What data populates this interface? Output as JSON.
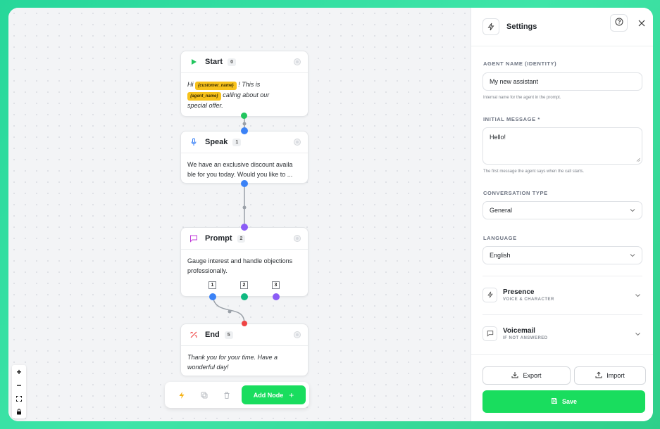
{
  "nodes": {
    "start": {
      "title": "Start",
      "badge": "0",
      "text_hi": "Hi",
      "var1": "{customer_name}",
      "text_mid": "! This is",
      "var2": "{agent_name}",
      "text_end1": "calling about our",
      "text_end2": "special offer."
    },
    "speak": {
      "title": "Speak",
      "badge": "1",
      "line1": "We have an exclusive discount availa",
      "line2": "ble for you today. Would you like to ..."
    },
    "prompt": {
      "title": "Prompt",
      "badge": "2",
      "line1": "Gauge interest and handle objections",
      "line2": "professionally.",
      "outputs": [
        "1",
        "2",
        "3"
      ]
    },
    "end": {
      "title": "End",
      "badge": "5",
      "line1": "Thank you for your time. Have a",
      "line2": "wonderful day!"
    }
  },
  "toolbar": {
    "add_node_label": "Add Node"
  },
  "zoom": {
    "plus": "+",
    "minus": "−"
  },
  "settings": {
    "title": "Settings",
    "agent_name_label": "AGENT NAME (IDENTITY)",
    "agent_name_value": "My new assistant",
    "agent_name_hint": "Internal name for the agent in the prompt.",
    "initial_message_label": "INITIAL MESSAGE *",
    "initial_message_value": "Hello!",
    "initial_message_hint": "The first message the agent says when the call starts.",
    "conversation_type_label": "CONVERSATION TYPE",
    "conversation_type_value": "General",
    "language_label": "LANGUAGE",
    "language_value": "English",
    "sections": [
      {
        "title": "Presence",
        "subtitle": "VOICE & CHARACTER"
      },
      {
        "title": "Voicemail",
        "subtitle": "IF NOT ANSWERED"
      }
    ],
    "export_label": "Export",
    "import_label": "Import",
    "save_label": "Save"
  },
  "colors": {
    "accent_green": "#19dd5e",
    "dot_green": "#22c55e",
    "dot_blue": "#3b82f6",
    "dot_purple": "#8b5cf6",
    "dot_teal": "#10b981",
    "dot_red": "#ef4444",
    "chip_yellow": "#f7c21c"
  },
  "icons": {
    "start": "play-icon",
    "speak": "microphone-icon",
    "prompt": "chat-bubble-icon",
    "end": "end-call-icon",
    "settings": "lightning-icon"
  }
}
